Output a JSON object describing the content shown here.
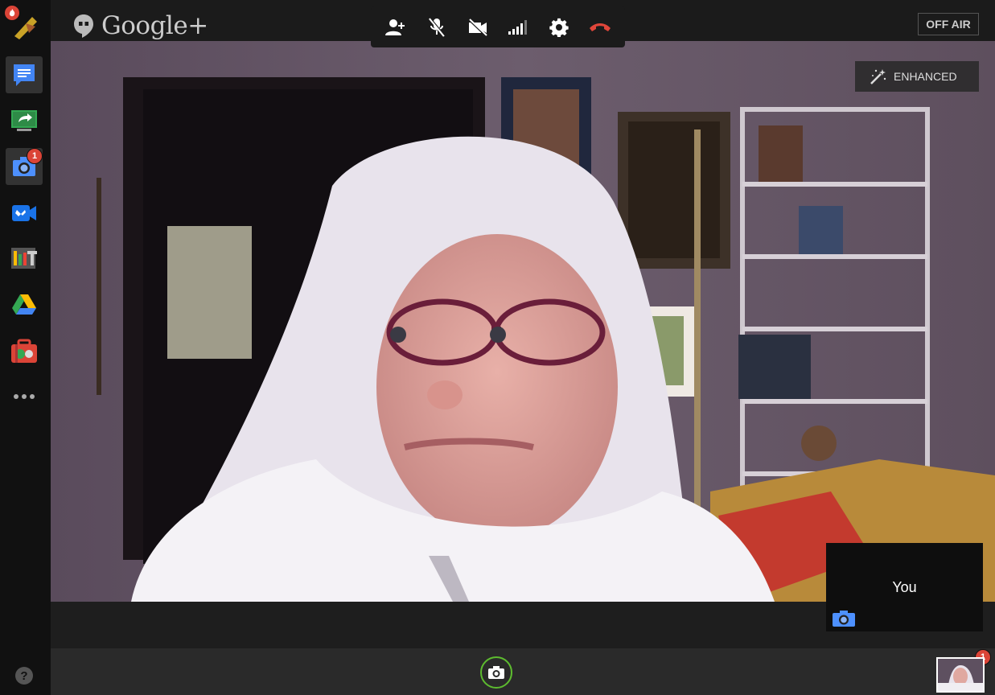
{
  "app": {
    "logo_text": "Google+",
    "logo_icon": "hangouts-quote-icon"
  },
  "sidebar": {
    "items": [
      {
        "name": "hangout-app-icon",
        "badge": ""
      },
      {
        "name": "chat-icon",
        "badge": ""
      },
      {
        "name": "screenshare-icon",
        "badge": ""
      },
      {
        "name": "capture-camera-icon",
        "badge": "1"
      },
      {
        "name": "remote-desktop-icon",
        "badge": ""
      },
      {
        "name": "control-room-icon",
        "badge": ""
      },
      {
        "name": "google-drive-icon",
        "badge": ""
      },
      {
        "name": "toolbox-icon",
        "badge": ""
      },
      {
        "name": "more-apps-icon",
        "badge": ""
      }
    ],
    "help_label": "?"
  },
  "toolbar": {
    "buttons": [
      "invite-people",
      "mute-microphone",
      "turn-off-camera",
      "bandwidth",
      "settings",
      "exit-call"
    ],
    "colors": {
      "exit": "#e0463a",
      "icon": "#ffffff"
    }
  },
  "broadcast": {
    "status_label": "OFF AIR"
  },
  "video": {
    "enhanced_label": "ENHANCED"
  },
  "self_view": {
    "label": "You"
  },
  "filmstrip": {
    "badge": "1"
  },
  "colors": {
    "accent_green": "#5dbb2f",
    "badge_red": "#db4437",
    "google_blue": "#4285f4"
  }
}
